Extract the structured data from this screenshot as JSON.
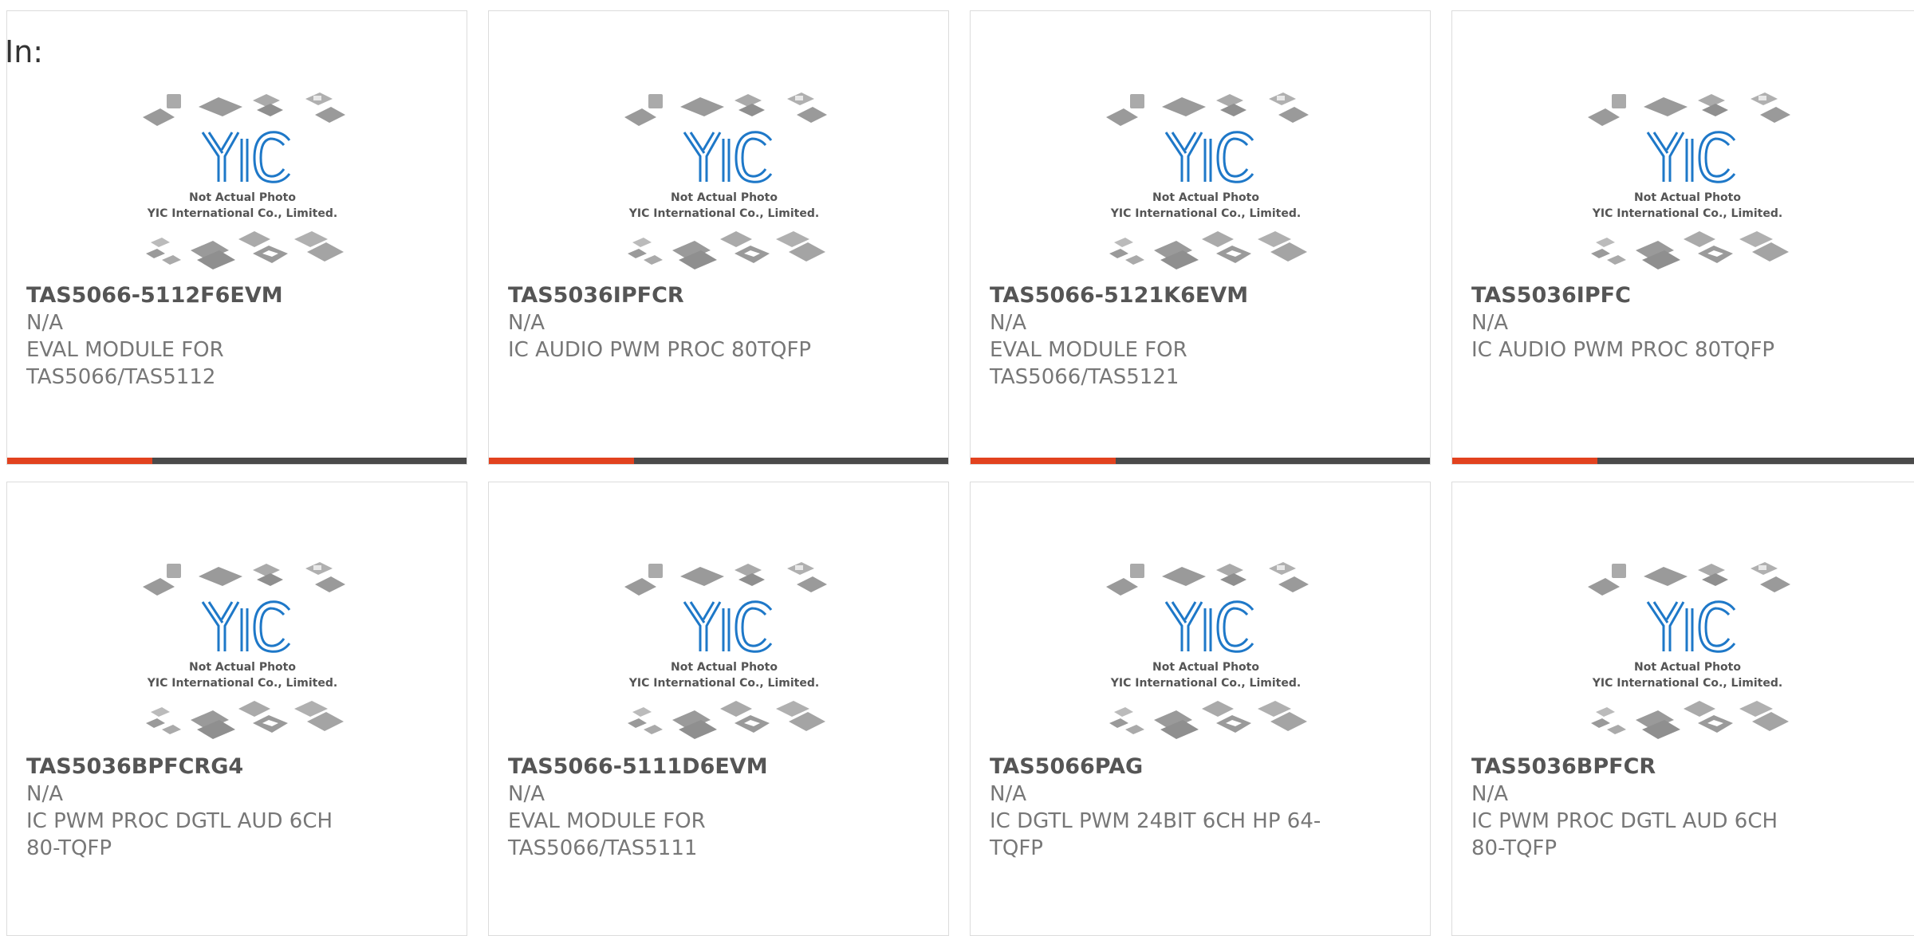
{
  "filter_label": "In:",
  "placeholder_photo": {
    "logo_text": "YIC",
    "line1": "Not Actual Photo",
    "line2": "YIC International Co., Limited."
  },
  "colors": {
    "accent": "#e2421f",
    "bar": "#4a4a4a",
    "logo": "#1e78c8"
  },
  "products": [
    {
      "part_number": "TAS5066-5112F6EVM",
      "manufacturer": "N/A",
      "description_line1": "EVAL MODULE FOR",
      "description_line2": "TAS5066/TAS5112"
    },
    {
      "part_number": "TAS5036IPFCR",
      "manufacturer": "N/A",
      "description_line1": "IC AUDIO PWM PROC 80TQFP",
      "description_line2": ""
    },
    {
      "part_number": "TAS5066-5121K6EVM",
      "manufacturer": "N/A",
      "description_line1": "EVAL MODULE FOR",
      "description_line2": "TAS5066/TAS5121"
    },
    {
      "part_number": "TAS5036IPFC",
      "manufacturer": "N/A",
      "description_line1": "IC AUDIO PWM PROC 80TQFP",
      "description_line2": ""
    },
    {
      "part_number": "TAS5036BPFCRG4",
      "manufacturer": "N/A",
      "description_line1": "IC PWM PROC DGTL AUD 6CH",
      "description_line2": "80-TQFP"
    },
    {
      "part_number": "TAS5066-5111D6EVM",
      "manufacturer": "N/A",
      "description_line1": "EVAL MODULE FOR",
      "description_line2": "TAS5066/TAS5111"
    },
    {
      "part_number": "TAS5066PAG",
      "manufacturer": "N/A",
      "description_line1": "IC DGTL PWM 24BIT 6CH HP 64-",
      "description_line2": "TQFP"
    },
    {
      "part_number": "TAS5036BPFCR",
      "manufacturer": "N/A",
      "description_line1": "IC PWM PROC DGTL AUD 6CH",
      "description_line2": "80-TQFP"
    }
  ]
}
